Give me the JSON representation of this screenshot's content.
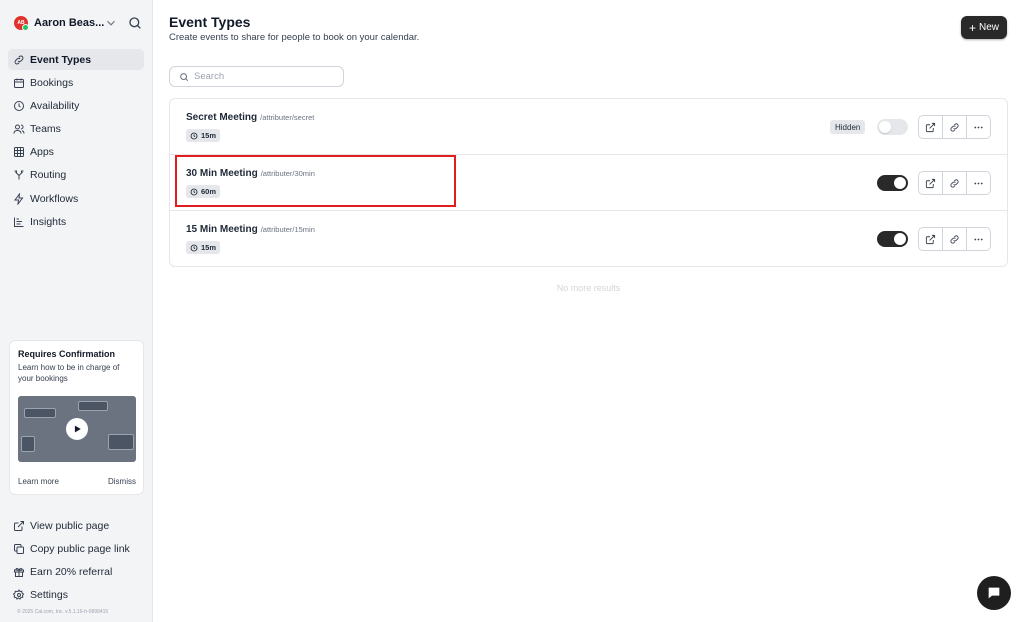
{
  "user": {
    "initials": "AB",
    "name": "Aaron Beas..."
  },
  "nav": [
    {
      "label": "Event Types",
      "icon": "link-icon",
      "active": true
    },
    {
      "label": "Bookings",
      "icon": "calendar-icon"
    },
    {
      "label": "Availability",
      "icon": "clock-icon"
    },
    {
      "label": "Teams",
      "icon": "users-icon"
    },
    {
      "label": "Apps",
      "icon": "grid-icon"
    },
    {
      "label": "Routing",
      "icon": "split-icon"
    },
    {
      "label": "Workflows",
      "icon": "zap-icon"
    },
    {
      "label": "Insights",
      "icon": "bar-chart-icon"
    }
  ],
  "promo": {
    "title": "Requires Confirmation",
    "description": "Learn how to be in charge of your bookings",
    "learn_more": "Learn more",
    "dismiss": "Dismiss"
  },
  "bottom_nav": [
    {
      "label": "View public page",
      "icon": "external-link-icon"
    },
    {
      "label": "Copy public page link",
      "icon": "copy-icon"
    },
    {
      "label": "Earn 20% referral",
      "icon": "gift-icon"
    },
    {
      "label": "Settings",
      "icon": "settings-icon"
    }
  ],
  "copyright": "© 2025 Cal.com, Inc. v.5.1.16-h-0899415",
  "header": {
    "title": "Event Types",
    "subtitle": "Create events to share for people to book on your calendar.",
    "new_button": "New"
  },
  "search": {
    "placeholder": "Search"
  },
  "events": [
    {
      "title": "Secret Meeting",
      "slug": "/attributer/secret",
      "duration": "15m",
      "hidden_label": "Hidden",
      "enabled": false
    },
    {
      "title": "30 Min Meeting",
      "slug": "/attributer/30min",
      "duration": "60m",
      "enabled": true
    },
    {
      "title": "15 Min Meeting",
      "slug": "/attributer/15min",
      "duration": "15m",
      "enabled": true
    }
  ],
  "no_more_results": "No more results",
  "colors": {
    "accent": "#292929",
    "highlight": "#e11d1d",
    "avatar": "#e0332d"
  }
}
